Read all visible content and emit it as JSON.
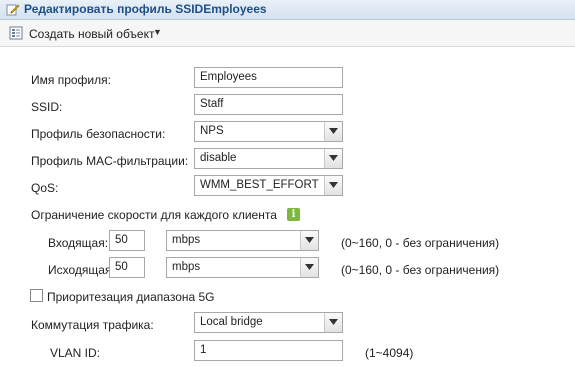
{
  "title": "Редактировать профиль SSIDEmployees",
  "toolbar": {
    "create_label": "Создать новый объект"
  },
  "form": {
    "profile_name": {
      "label": "Имя профиля:",
      "value": "Employees"
    },
    "ssid": {
      "label": "SSID:",
      "value": "Staff"
    },
    "security_profile": {
      "label": "Профиль безопасности:",
      "value": "NPS"
    },
    "mac_filter_profile": {
      "label": "Профиль MAC-фильтрации:",
      "value": "disable"
    },
    "qos": {
      "label": "QoS:",
      "value": "WMM_BEST_EFFORT"
    },
    "rate_limit_title": "Ограничение скорости для каждого клиента",
    "incoming": {
      "label": "Входящая:",
      "value": "50",
      "unit": "mbps",
      "hint": "(0~160, 0 - без ограничения)"
    },
    "outgoing": {
      "label": "Исходящая:",
      "value": "50",
      "unit": "mbps",
      "hint": "(0~160, 0 - без ограничения)"
    },
    "band5g": {
      "label": "Приоритезация диапазона 5G",
      "checked": false
    },
    "switching": {
      "label": "Коммутация трафика:",
      "value": "Local bridge"
    },
    "vlan": {
      "label": "VLAN ID:",
      "value": "1",
      "hint": "(1~4094)"
    }
  },
  "icons": {
    "title": "edit-pencil-icon",
    "toolbar": "new-object-icon",
    "info": "info-icon"
  }
}
